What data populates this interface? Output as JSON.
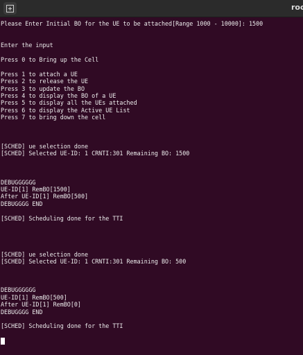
{
  "window": {
    "title": "roo",
    "new_tab_icon": "new-tab-icon"
  },
  "terminal": {
    "background": "#300a24",
    "lines": [
      "Please Enter Initial BO for the UE to be attached[Range 1000 - 10000]: 1500",
      "",
      "",
      "Enter the input",
      "",
      "Press 0 to Bring up the Cell",
      "",
      "Press 1 to attach a UE",
      "Press 2 to release the UE",
      "Press 3 to update the BO",
      "Press 4 to display the BO of a UE",
      "Press 5 to display all the UEs attached",
      "Press 6 to display the Active UE List",
      "Press 7 to bring down the cell",
      "",
      "",
      "",
      "[SCHED] ue selection done",
      "[SCHED] Selected UE-ID: 1 CRNTI:301 Remaining BO: 1500",
      "",
      "",
      "",
      "DEBUGGGGGG",
      "UE-ID[1] RemBO[1500]",
      "After UE-ID[1] RemBO[500]",
      "DEBUGGGG END",
      "",
      "[SCHED] Scheduling done for the TTI",
      "",
      "",
      "",
      "",
      "[SCHED] ue selection done",
      "[SCHED] Selected UE-ID: 1 CRNTI:301 Remaining BO: 500",
      "",
      "",
      "",
      "DEBUGGGGGG",
      "UE-ID[1] RemBO[500]",
      "After UE-ID[1] RemBO[0]",
      "DEBUGGGG END",
      "",
      "[SCHED] Scheduling done for the TTI",
      ""
    ]
  }
}
